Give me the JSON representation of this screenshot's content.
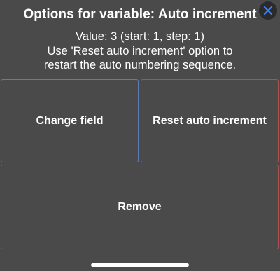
{
  "dialog": {
    "title": "Options for variable: Auto increment",
    "info_lines": [
      "Value: 3 (start: 1, step: 1)",
      "Use 'Reset auto increment' option to",
      "restart the auto numbering sequence."
    ],
    "close_icon": "close-icon"
  },
  "buttons": {
    "change_field": "Change field",
    "reset_auto_increment": "Reset auto increment",
    "remove": "Remove"
  },
  "colors": {
    "background": "#4a4a4a",
    "close_accent": "#3b82f6",
    "change_border": "#5d7bb5",
    "destructive_border": "#b05050"
  }
}
